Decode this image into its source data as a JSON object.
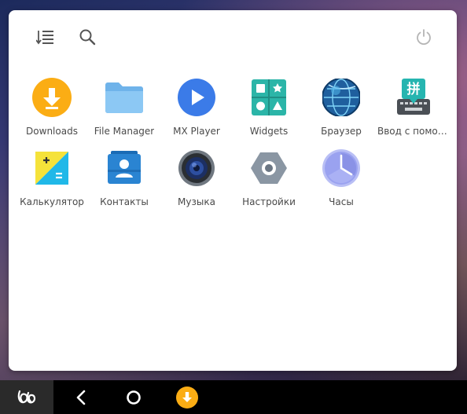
{
  "colors": {
    "downloads_orange": "#fbad14",
    "folder_blue": "#8cc8f4",
    "mxplayer_blue": "#3b7be8",
    "widgets_teal": "#2bb5a8",
    "calculator_yellow": "#f5e23a",
    "calculator_cyan": "#20b8e8",
    "contacts_blue": "#2a84d2",
    "settings_gray": "#8a96a3",
    "clock_purple": "#9aa2f0"
  },
  "topbar": {
    "sort_icon": "sort-list-icon",
    "search_icon": "search-icon",
    "power_icon": "power-icon"
  },
  "apps": [
    {
      "label": "Downloads",
      "icon": "downloads-icon"
    },
    {
      "label": "File Manager",
      "icon": "folder-icon"
    },
    {
      "label": "MX Player",
      "icon": "play-icon"
    },
    {
      "label": "Widgets",
      "icon": "widgets-icon"
    },
    {
      "label": "Браузер",
      "icon": "globe-icon"
    },
    {
      "label": "Ввод с помощ...",
      "icon": "keyboard-icon"
    },
    {
      "label": "Калькулятор",
      "icon": "calculator-icon"
    },
    {
      "label": "Контакты",
      "icon": "contacts-icon"
    },
    {
      "label": "Музыка",
      "icon": "speaker-icon"
    },
    {
      "label": "Настройки",
      "icon": "settings-icon"
    },
    {
      "label": "Часы",
      "icon": "clock-icon"
    }
  ],
  "navbar": {
    "home_logo": "jide-logo-icon",
    "back": "back-icon",
    "home": "home-circle-icon",
    "running_app": "downloads-icon"
  }
}
